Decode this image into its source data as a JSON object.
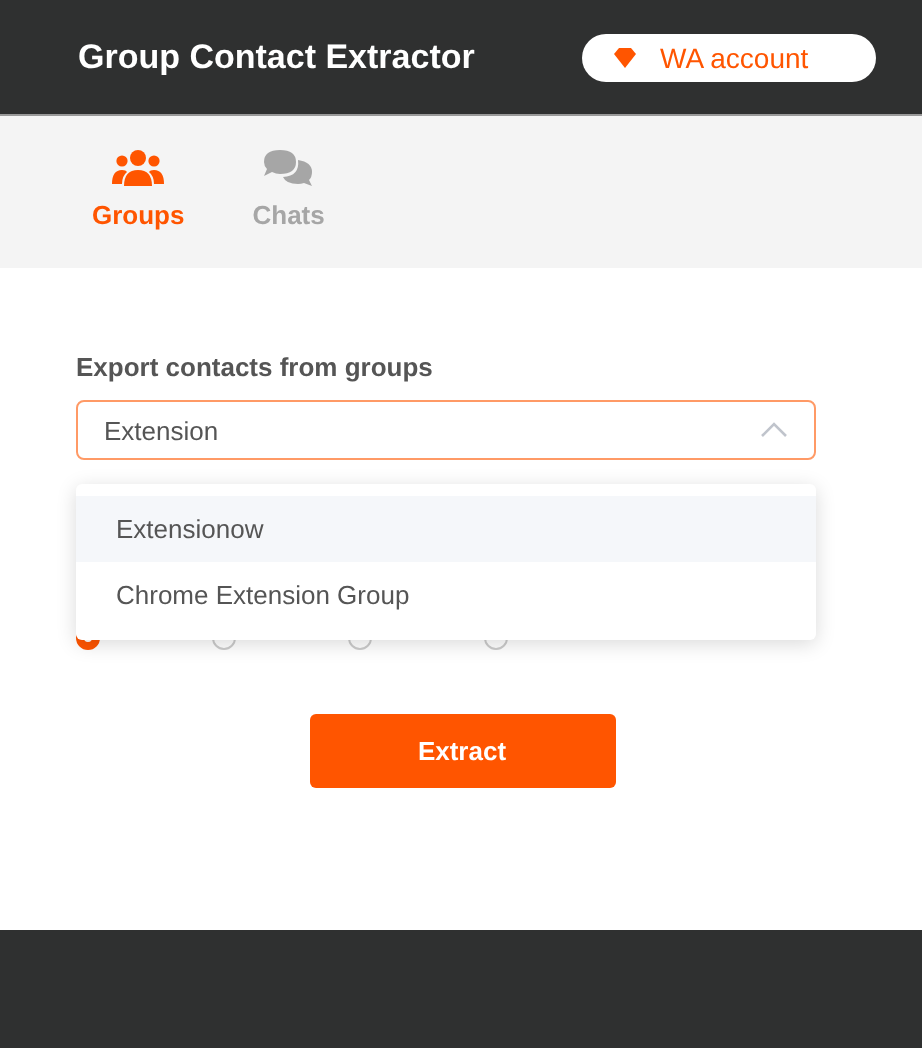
{
  "header": {
    "title": "Group Contact Extractor",
    "account_button": "WA account"
  },
  "tabs": [
    {
      "label": "Groups",
      "selected": true
    },
    {
      "label": "Chats",
      "selected": false
    }
  ],
  "form": {
    "label": "Export contacts from groups",
    "select_value": "Extension",
    "expanded": true,
    "options": [
      {
        "label": "Extensionow",
        "selected": true
      },
      {
        "label": "Chrome Extension Group",
        "selected": false
      }
    ],
    "formats": [
      {
        "selected": true
      },
      {
        "selected": false
      },
      {
        "selected": false
      },
      {
        "selected": false
      }
    ]
  },
  "extract_button": "Extract"
}
